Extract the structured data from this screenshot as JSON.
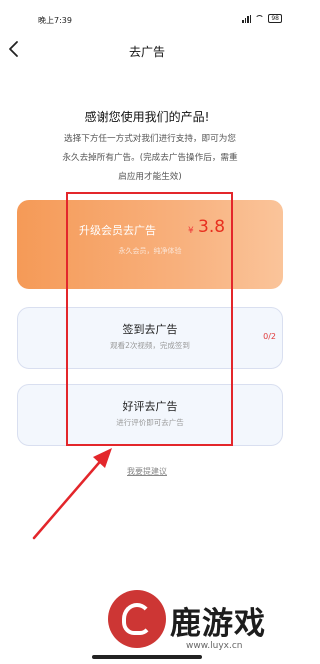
{
  "status_bar": {
    "time": "晚上7:39",
    "battery": "98"
  },
  "nav": {
    "title": "去广告"
  },
  "intro": {
    "title": "感谢您使用我们的产品!",
    "line1": "选择下方任一方式对我们进行支持，即可为您",
    "line2": "永久去掉所有广告。(完成去广告操作后，需重",
    "line3": "启应用才能生效)"
  },
  "options": {
    "vip": {
      "title": "升级会员去广告",
      "currency": "¥",
      "price": "3.8",
      "subtitle": "永久会员，纯净体验"
    },
    "sign": {
      "title": "签到去广告",
      "subtitle": "观看2次视频，完成签到",
      "progress": "0/2"
    },
    "review": {
      "title": "好评去广告",
      "subtitle": "进行评价即可去广告"
    }
  },
  "suggest_link": "我要提建议",
  "watermark": {
    "brand": "鹿游戏",
    "url": "www.luyx.cn"
  },
  "colors": {
    "vip_gradient_start": "#f59a57",
    "highlight": "#e3262b",
    "price": "#e8301f"
  }
}
